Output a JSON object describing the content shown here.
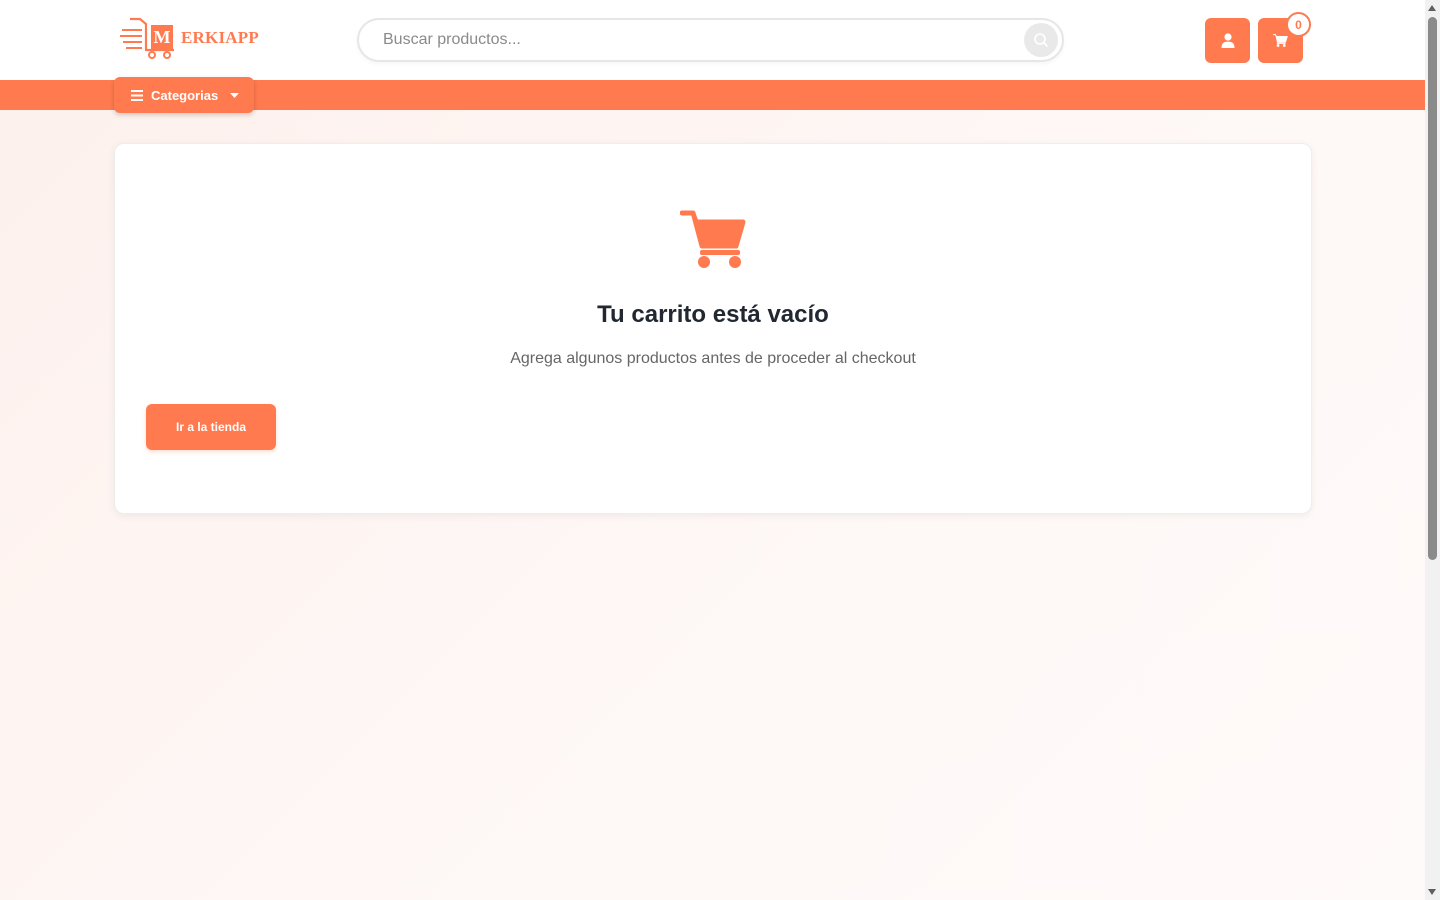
{
  "brand": {
    "logo_letter": "M",
    "logo_rest": "ERKIAPP"
  },
  "search": {
    "placeholder": "Buscar productos..."
  },
  "header": {
    "cart_count": "0"
  },
  "nav": {
    "categories_label": "Categorias"
  },
  "empty_cart": {
    "title": "Tu carrito está vacío",
    "subtitle": "Agrega algunos productos antes de proceder al checkout",
    "button_label": "Ir a la tienda"
  },
  "colors": {
    "accent": "#ff7a4f",
    "title": "#222831",
    "subtitle": "#666666"
  },
  "icons": [
    "logo-cart-icon",
    "search-icon",
    "user-icon",
    "cart-icon",
    "menu-icon",
    "caret-down-icon",
    "empty-cart-icon"
  ]
}
